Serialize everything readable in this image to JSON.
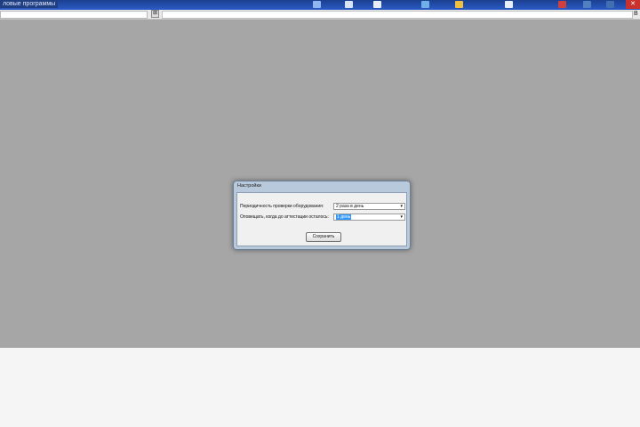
{
  "topbar": {
    "label": "ловые программы",
    "close_glyph": "✕"
  },
  "toolbar": {
    "left_button_glyph": "⊠",
    "right_button_glyph": "В"
  },
  "dialog": {
    "title": "Настройки",
    "rows": [
      {
        "label": "Периодичность проверки оборудования:",
        "value": "2 раза в день"
      },
      {
        "label": "Оповещать, когда до аттестации осталось:",
        "value": "1 день"
      }
    ],
    "save_label": "Сохранить",
    "arrow_glyph": "▾"
  },
  "colors": {
    "overlay": "#a6a6a6",
    "dialog_frame": "#b9c9dc",
    "selection": "#3399ff"
  }
}
